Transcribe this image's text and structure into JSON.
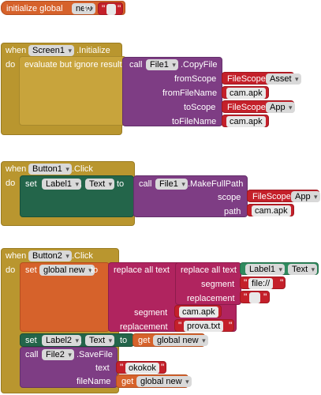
{
  "init_global": {
    "prefix": "initialize global",
    "name": "new",
    "to": "to",
    "value": ""
  },
  "screen1": {
    "when": "when",
    "component": "Screen1",
    "event": ".Initialize",
    "do": "do",
    "evaluate": "evaluate but ignore result",
    "call": "call",
    "file_comp": "File1",
    "method": ".CopyFile",
    "params": [
      {
        "label": "fromScope",
        "comp": "FileScope",
        "value": "Asset"
      },
      {
        "label": "fromFileName",
        "text": "cam.apk"
      },
      {
        "label": "toScope",
        "comp": "FileScope",
        "value": "App"
      },
      {
        "label": "toFileName",
        "text": "cam.apk"
      }
    ]
  },
  "button1": {
    "when": "when",
    "component": "Button1",
    "event": ".Click",
    "do": "do",
    "set": "set",
    "label_comp": "Label1",
    "dot": ".",
    "prop": "Text",
    "to": "to",
    "call": "call",
    "file_comp": "File1",
    "method": ".MakeFullPath",
    "scope_label": "scope",
    "scope_comp": "FileScope",
    "scope_value": "App",
    "path_label": "path",
    "path_text": "cam.apk"
  },
  "button2": {
    "when": "when",
    "component": "Button2",
    "event": ".Click",
    "do": "do",
    "set": "set",
    "global_var": "global new",
    "to": "to",
    "replace1": "replace all text",
    "replace2": "replace all text",
    "label_comp": "Label1",
    "dot": ".",
    "prop": "Text",
    "segment_label": "segment",
    "segment_text1": "file://",
    "replacement_label": "replacement",
    "replacement_text1": "",
    "segment_text2": "cam.apk",
    "replacement_text2": "prova.txt",
    "set2": "set",
    "label2_comp": "Label2",
    "prop2": "Text",
    "to2": "to",
    "get": "get",
    "get_var": "global new",
    "call": "call",
    "file_comp": "File2",
    "method": ".SaveFile",
    "text_label": "text",
    "text_value": "okokok",
    "filename_label": "fileName",
    "get2": "get",
    "get_var2": "global new"
  },
  "colors": {
    "event": "#b9962f",
    "procedure": "#7e3d84",
    "text": "#b32d5e",
    "constant": "#c4202a",
    "variable": "#d6622b",
    "setter": "#23654a"
  }
}
